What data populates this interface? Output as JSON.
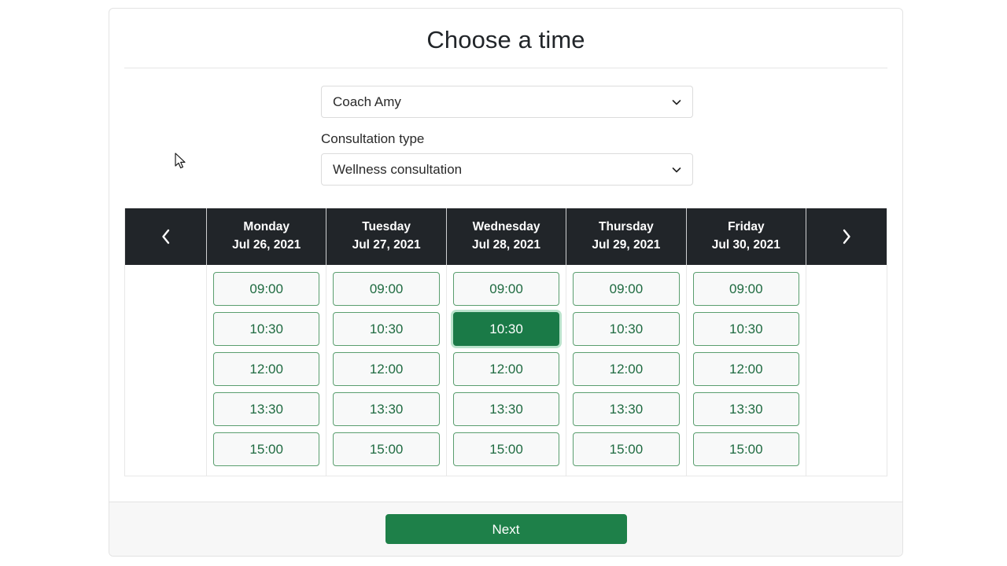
{
  "dialog": {
    "title": "Choose a time"
  },
  "form": {
    "coach_select": {
      "value": "Coach Amy",
      "icon": "chevron-down-icon"
    },
    "consultation_label": "Consultation type",
    "consultation_select": {
      "value": "Wellness consultation",
      "icon": "chevron-down-icon"
    }
  },
  "calendar": {
    "prev_icon": "chevron-left-icon",
    "next_icon": "chevron-right-icon",
    "columns": [
      {
        "day": "Monday",
        "date": "Jul 26, 2021",
        "slots": [
          {
            "time": "09:00",
            "selected": false
          },
          {
            "time": "10:30",
            "selected": false
          },
          {
            "time": "12:00",
            "selected": false
          },
          {
            "time": "13:30",
            "selected": false
          },
          {
            "time": "15:00",
            "selected": false
          }
        ]
      },
      {
        "day": "Tuesday",
        "date": "Jul 27, 2021",
        "slots": [
          {
            "time": "09:00",
            "selected": false
          },
          {
            "time": "10:30",
            "selected": false
          },
          {
            "time": "12:00",
            "selected": false
          },
          {
            "time": "13:30",
            "selected": false
          },
          {
            "time": "15:00",
            "selected": false
          }
        ]
      },
      {
        "day": "Wednesday",
        "date": "Jul 28, 2021",
        "slots": [
          {
            "time": "09:00",
            "selected": false
          },
          {
            "time": "10:30",
            "selected": true
          },
          {
            "time": "12:00",
            "selected": false
          },
          {
            "time": "13:30",
            "selected": false
          },
          {
            "time": "15:00",
            "selected": false
          }
        ]
      },
      {
        "day": "Thursday",
        "date": "Jul 29, 2021",
        "slots": [
          {
            "time": "09:00",
            "selected": false
          },
          {
            "time": "10:30",
            "selected": false
          },
          {
            "time": "12:00",
            "selected": false
          },
          {
            "time": "13:30",
            "selected": false
          },
          {
            "time": "15:00",
            "selected": false
          }
        ]
      },
      {
        "day": "Friday",
        "date": "Jul 30, 2021",
        "slots": [
          {
            "time": "09:00",
            "selected": false
          },
          {
            "time": "10:30",
            "selected": false
          },
          {
            "time": "12:00",
            "selected": false
          },
          {
            "time": "13:30",
            "selected": false
          },
          {
            "time": "15:00",
            "selected": false
          }
        ]
      }
    ]
  },
  "footer": {
    "next_label": "Next"
  },
  "colors": {
    "accent_green": "#1e8049",
    "selected_green": "#1a7a47",
    "slot_text_green": "#1f6b41",
    "header_dark": "#212529"
  }
}
